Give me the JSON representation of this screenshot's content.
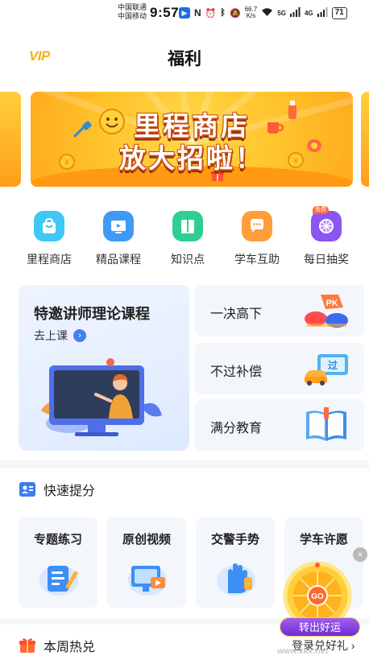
{
  "status_bar": {
    "carrier_1": "中国联通",
    "carrier_2": "中国移动",
    "time": "9:57",
    "net_speed_value": "66.7",
    "net_speed_unit": "K/s",
    "signal_1": "5G",
    "signal_2": "4G",
    "battery": "71"
  },
  "header": {
    "vip_label": "VIP",
    "title": "福利"
  },
  "banner": {
    "line1": "里程商店",
    "line2": "放大招啦！"
  },
  "quick_nav": [
    {
      "label": "里程商店",
      "icon": "shop-bag-icon",
      "color": "#37c6f4"
    },
    {
      "label": "精品课程",
      "icon": "video-course-icon",
      "color": "#3f9af5"
    },
    {
      "label": "知识点",
      "icon": "book-icon",
      "color": "#2fcf8f"
    },
    {
      "label": "学车互助",
      "icon": "chat-bubble-icon",
      "color": "#ff9e3a"
    },
    {
      "label": "每日抽奖",
      "icon": "prize-wheel-icon",
      "color": "#8a55f0",
      "badge": "免费"
    }
  ],
  "feature": {
    "big_card": {
      "title": "特邀讲师理论课程",
      "subtitle": "去上课",
      "arrow": "›"
    },
    "side_cards": [
      {
        "label": "一决高下",
        "art": "pk-icon"
      },
      {
        "label": "不过补偿",
        "art": "car-ticket-icon"
      },
      {
        "label": "满分教育",
        "art": "open-book-icon"
      }
    ]
  },
  "pk_text": "PK",
  "ticket_text": "过",
  "section_quick": {
    "title": "快速提分",
    "items": [
      {
        "label": "专题练习",
        "icon": "notepad-pen-icon"
      },
      {
        "label": "原创视频",
        "icon": "monitor-play-icon"
      },
      {
        "label": "交警手势",
        "icon": "raised-hand-icon"
      },
      {
        "label": "学车许愿",
        "icon": "wish-icon"
      }
    ]
  },
  "section_hot": {
    "title": "本周热兑"
  },
  "floating": {
    "close": "×",
    "wheel_center": "GO",
    "button": "转出好运",
    "subtitle": "登录兑好礼 ›",
    "watermark": "www.kkx.net"
  }
}
